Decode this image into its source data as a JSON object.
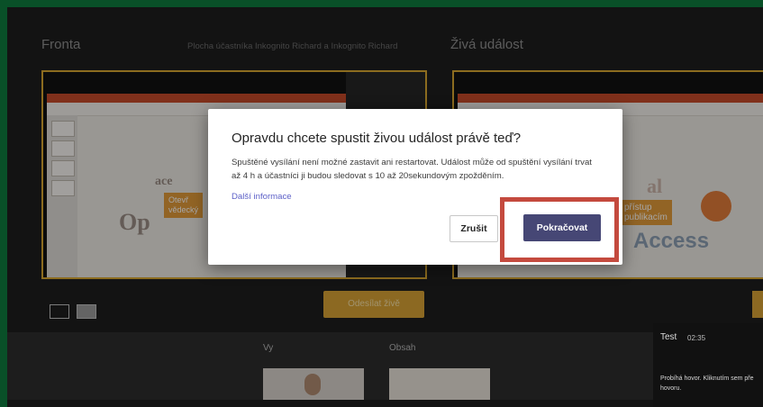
{
  "queue": {
    "title": "Fronta",
    "subtitle": "Plocha účastníka Inkognito Richard a Inkognito Richard",
    "slide_snippets": [
      "Otevř",
      "vědecký",
      "Op",
      "ace"
    ]
  },
  "live": {
    "title": "Živá událost",
    "slide_snippets": [
      "přístup",
      "publikacím",
      "Access",
      "al"
    ]
  },
  "controls": {
    "send_live_label": "Odesílat živě"
  },
  "participants": {
    "you_label": "Vy",
    "content_label": "Obsah"
  },
  "dialog": {
    "title": "Opravdu chcete spustit živou událost právě teď?",
    "body": "Spuštěné vysílání není možné zastavit ani restartovat. Událost může od spuštění vysílání trvat až 4 h a účastníci ji budou sledovat s 10 až 20sekundovým zpožděním.",
    "link": "Další informace",
    "cancel_label": "Zrušit",
    "continue_label": "Pokračovat"
  },
  "call_panel": {
    "title": "Test",
    "time": "02:35",
    "message": "Probíhá hovor. Kliknutím sem pře hovoru."
  },
  "colors": {
    "accent": "#d7a235",
    "primary_button": "#464775",
    "highlight": "#c44a3e",
    "frame": "#0f7b3e"
  }
}
